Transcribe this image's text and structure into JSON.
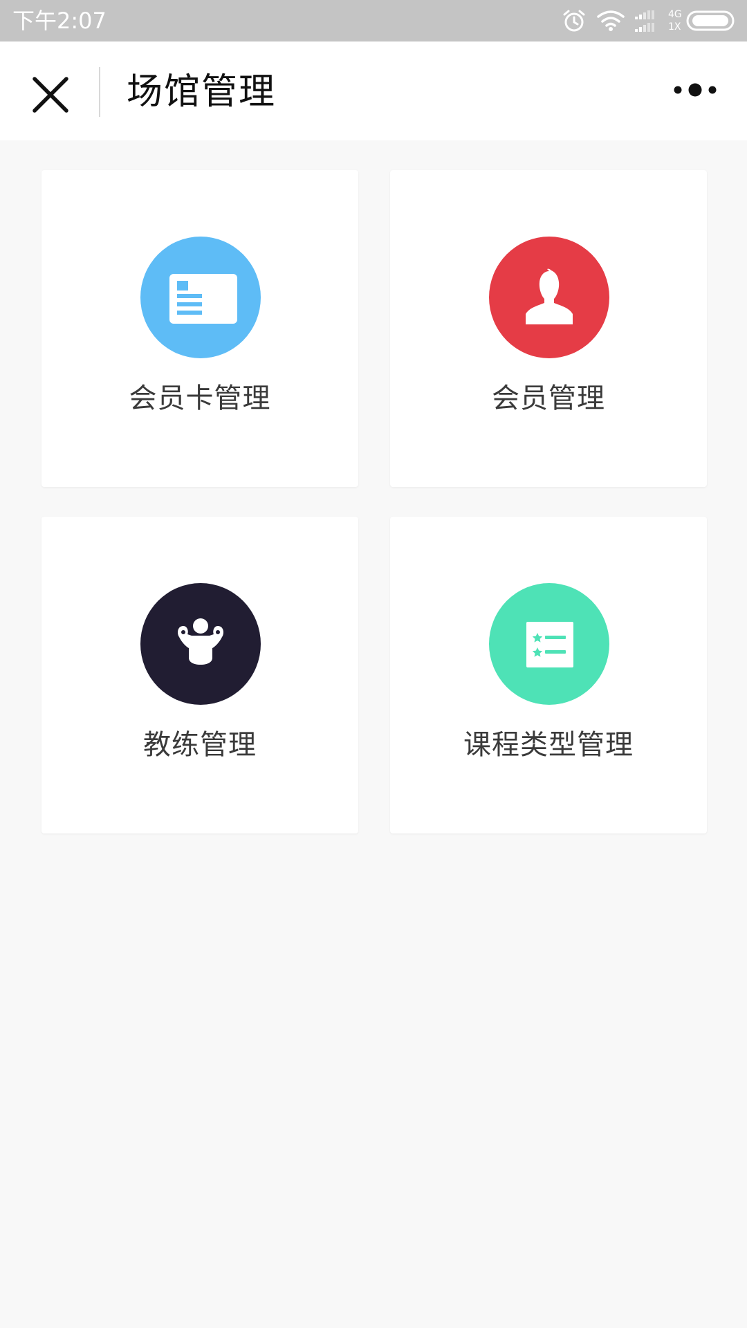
{
  "status_bar": {
    "time": "下午2:07",
    "network_top": "4G",
    "network_bottom": "1X",
    "icons": [
      "alarm-icon",
      "wifi-icon",
      "signal-icon",
      "battery-icon"
    ]
  },
  "header": {
    "title": "场馆管理",
    "close_icon": "close-icon",
    "more_icon": "more-dots-icon"
  },
  "cards": [
    {
      "label": "会员卡管理",
      "icon": "membership-card-icon",
      "color": "#5ebcf6"
    },
    {
      "label": "会员管理",
      "icon": "member-person-icon",
      "color": "#e53c46"
    },
    {
      "label": "教练管理",
      "icon": "coach-muscle-icon",
      "color": "#211d32"
    },
    {
      "label": "课程类型管理",
      "icon": "course-list-icon",
      "color": "#4ee2b6"
    }
  ]
}
